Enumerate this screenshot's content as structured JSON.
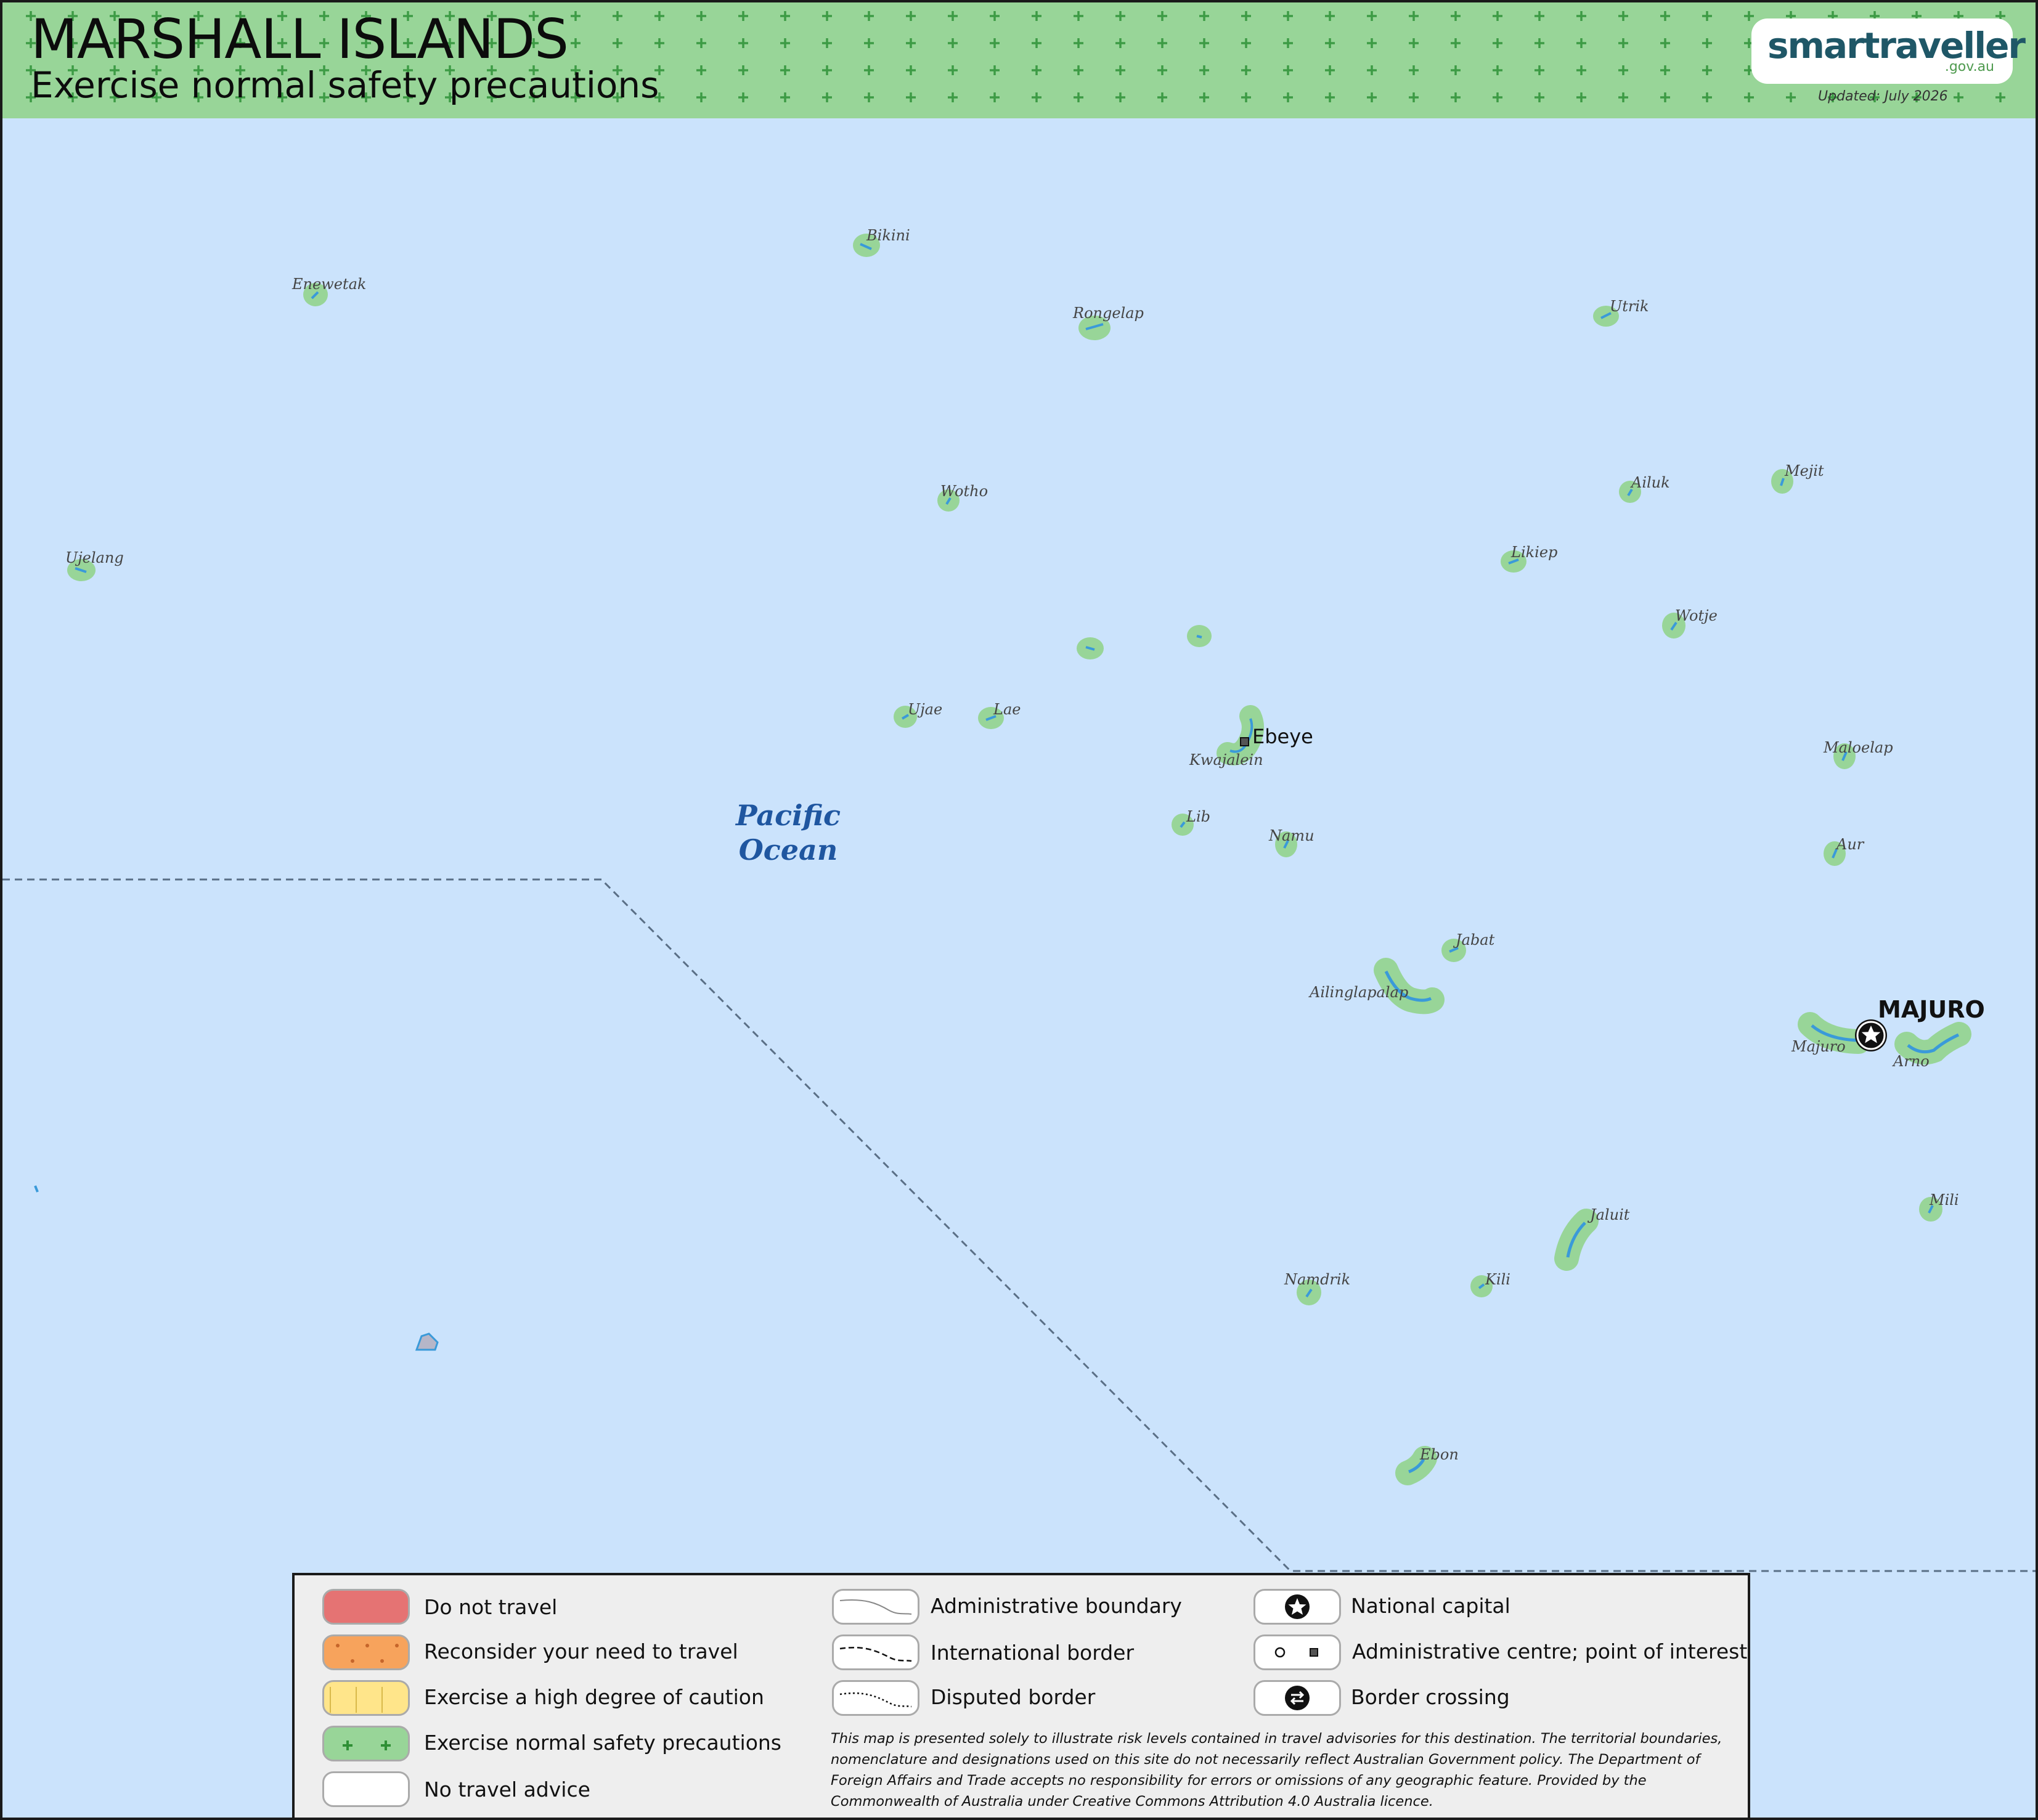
{
  "header": {
    "country": "MARSHALL ISLANDS",
    "advice_level": "Exercise normal safety precautions",
    "logo_name": "smartraveller",
    "logo_domain": ".gov.au",
    "updated": "Updated: July 2026",
    "level_color": "#98d598"
  },
  "ocean_label": {
    "line1": "Pacific",
    "line2": "Ocean"
  },
  "atolls": {
    "enewetak": "Enewetak",
    "bikini": "Bikini",
    "rongelap": "Rongelap",
    "utrik": "Utrik",
    "wotho": "Wotho",
    "ailuk": "Ailuk",
    "mejit": "Mejit",
    "ujelang": "Ujelang",
    "likiep": "Likiep",
    "wotje": "Wotje",
    "ujae": "Ujae",
    "lae": "Lae",
    "kwajalein": "Kwajalein",
    "maloelap": "Maloelap",
    "lib": "Lib",
    "namu": "Namu",
    "aur": "Aur",
    "jabat": "Jabat",
    "ailinglapalap": "Ailinglapalap",
    "majuro_atoll": "Majuro",
    "arno": "Arno",
    "mili": "Mili",
    "jaluit": "Jaluit",
    "namdrik": "Namdrik",
    "kili": "Kili",
    "ebon": "Ebon"
  },
  "places": {
    "ebeye": "Ebeye",
    "capital": "MAJURO"
  },
  "legend": {
    "risk_levels": [
      {
        "label": "Do not travel",
        "color": "#e57373"
      },
      {
        "label": "Reconsider your need to travel",
        "color": "#f7a35c"
      },
      {
        "label": "Exercise a high degree of caution",
        "color": "#ffe58a"
      },
      {
        "label": "Exercise normal safety precautions",
        "color": "#98d598"
      },
      {
        "label": "No travel advice",
        "color": "#ffffff"
      }
    ],
    "lines": [
      {
        "label": "Administrative boundary"
      },
      {
        "label": "International border"
      },
      {
        "label": "Disputed border"
      }
    ],
    "symbols": [
      {
        "label": "National capital"
      },
      {
        "label": "Administrative centre; point of interest"
      },
      {
        "label": "Border crossing"
      }
    ],
    "disclaimer": "This map is presented solely to illustrate risk levels contained in travel advisories for this destination. The territorial boundaries, nomenclature and designations used on this site do not necessarily reflect Australian Government policy. The Department of Foreign Affairs and Trade accepts no responsibility for errors or omissions of any geographic feature. Provided by the Commonwealth of Australia under Creative Commons Attribution 4.0 Australia licence."
  },
  "colors": {
    "sea": "#cbe3fc",
    "land_halo": "#98d598",
    "reef": "#3a9ad9",
    "border": "#5a6f86",
    "ocean_label": "#1f56a0"
  }
}
